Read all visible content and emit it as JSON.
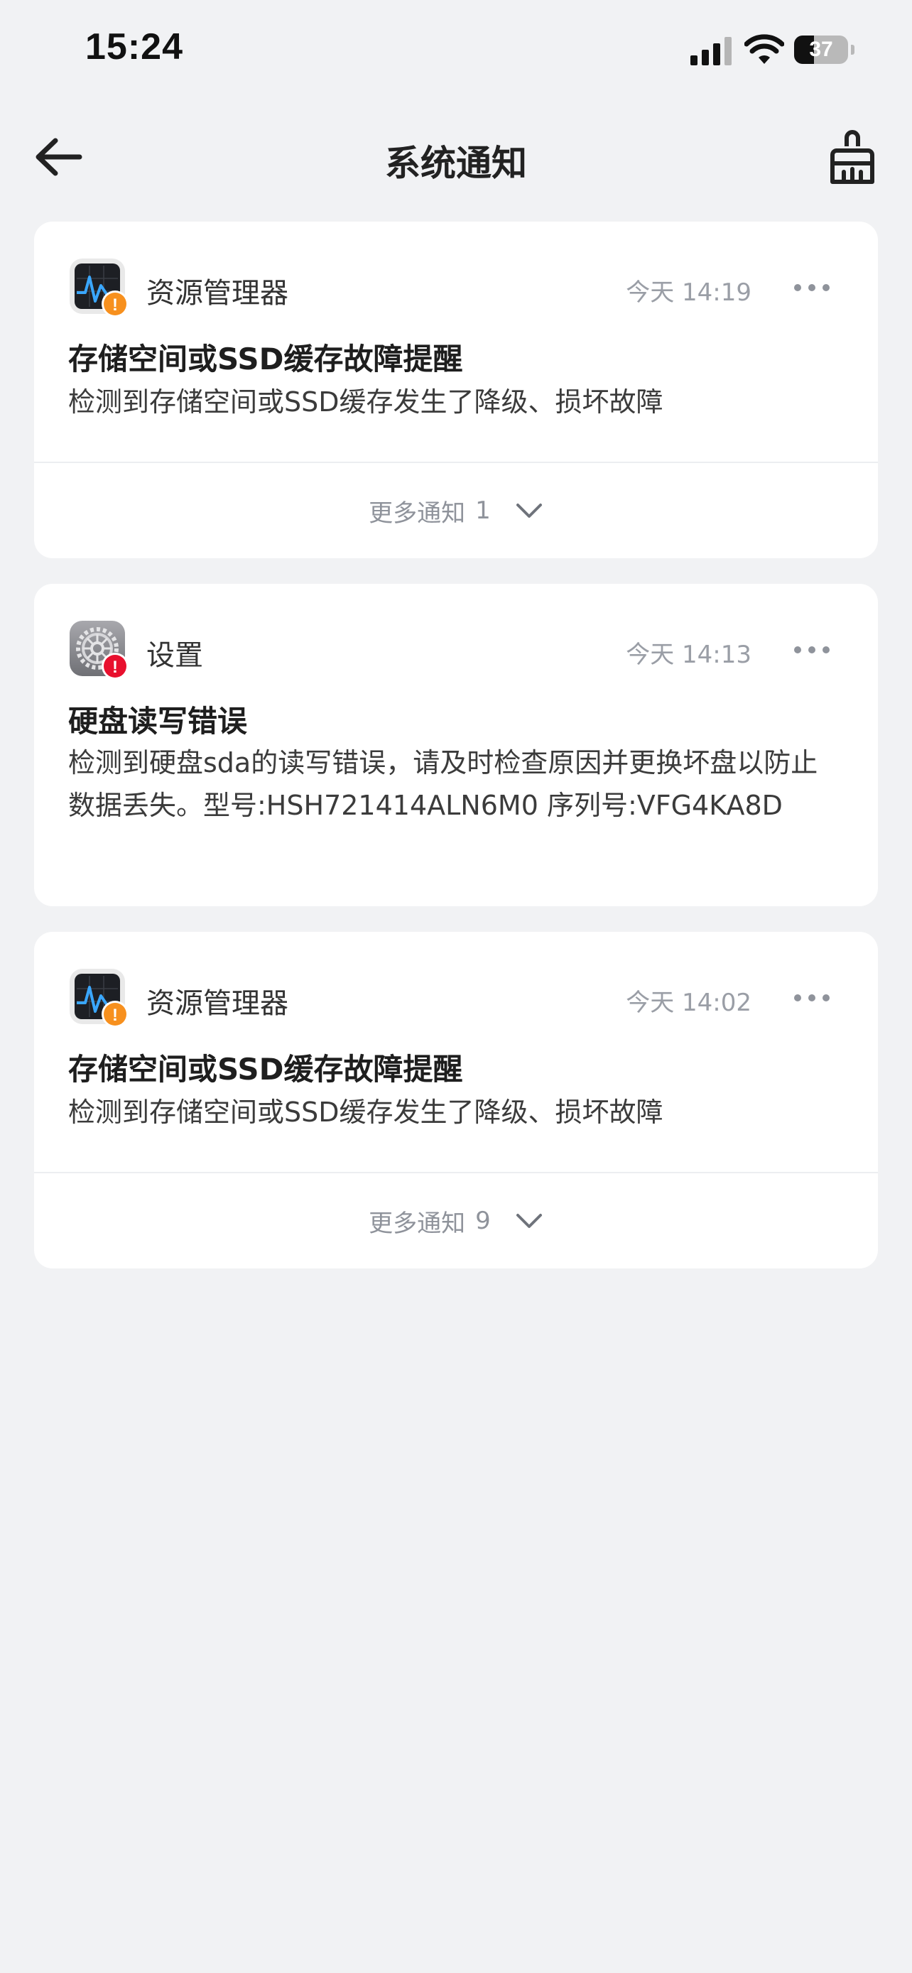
{
  "status_bar": {
    "time": "15:24",
    "battery_level": "37",
    "battery_fraction": 0.37
  },
  "header": {
    "title": "系统通知",
    "back_icon": "arrow-left-icon",
    "clear_icon": "broom-icon"
  },
  "notifications": [
    {
      "app_name": "资源管理器",
      "app_icon": "activity-monitor-icon",
      "badge": "!",
      "badge_color": "#f7901e",
      "time": "今天 14:19",
      "title": "存储空间或SSD缓存故障提醒",
      "description": "检测到存储空间或SSD缓存发生了降级、损坏故障",
      "more": {
        "label": "更多通知",
        "count": "1"
      }
    },
    {
      "app_name": "设置",
      "app_icon": "settings-gear-icon",
      "badge": "!",
      "badge_color": "#e8102e",
      "time": "今天 14:13",
      "title": "硬盘读写错误",
      "description": "检测到硬盘sda的读写错误，请及时检查原因并更换坏盘以防止数据丢失。型号:HSH721414ALN6M0 序列号:VFG4KA8D"
    },
    {
      "app_name": "资源管理器",
      "app_icon": "activity-monitor-icon",
      "badge": "!",
      "badge_color": "#f7901e",
      "time": "今天 14:02",
      "title": "存储空间或SSD缓存故障提醒",
      "description": "检测到存储空间或SSD缓存发生了降级、损坏故障",
      "more": {
        "label": "更多通知",
        "count": "9"
      }
    }
  ],
  "colors": {
    "background": "#f1f2f4",
    "card": "#ffffff",
    "warning": "#f7901e",
    "error": "#e8102e",
    "muted_text": "#9a9ea6"
  }
}
